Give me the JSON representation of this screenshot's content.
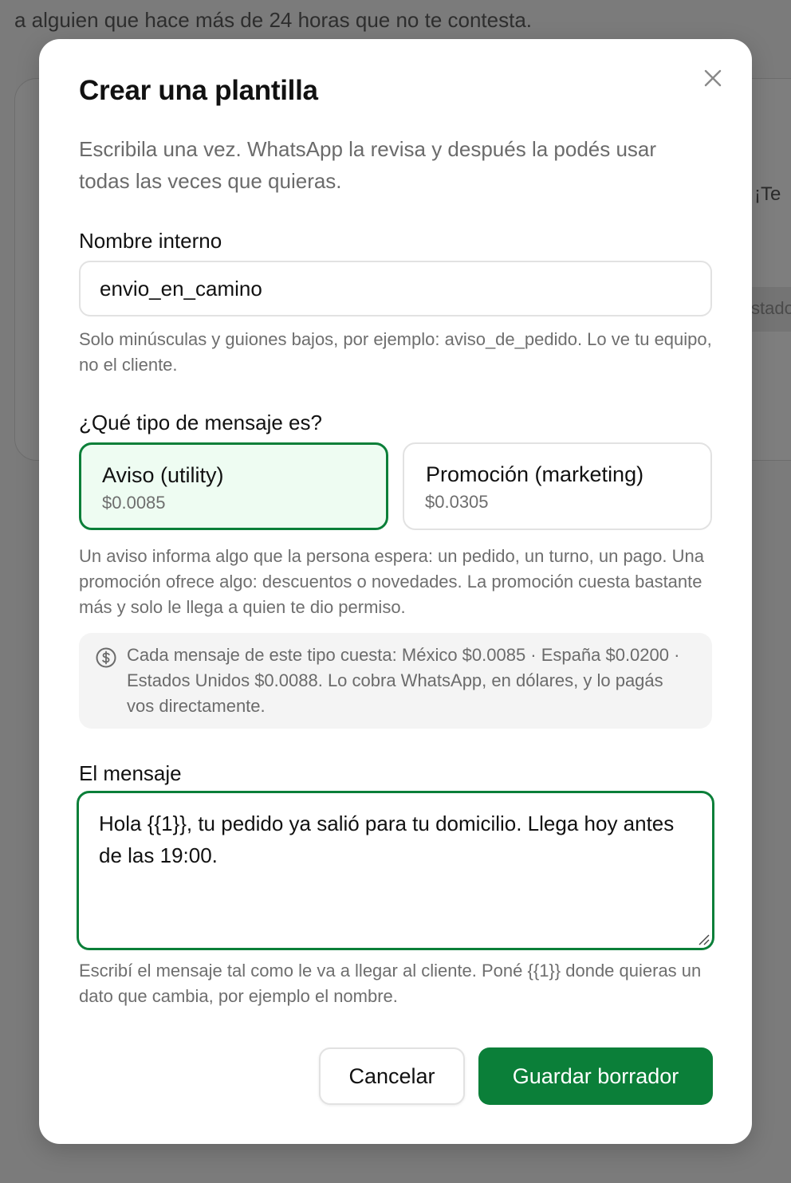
{
  "background": {
    "top_text": "a alguien que hace más de 24 horas que no te contesta.",
    "snippet_1": "¡Te",
    "snippet_2": "stado"
  },
  "modal": {
    "title": "Crear una plantilla",
    "subtitle": "Escribila una vez. WhatsApp la revisa y después la podés usar todas las veces que quieras.",
    "close_icon": "close-icon",
    "name_field": {
      "label": "Nombre interno",
      "value": "envio_en_camino",
      "hint": "Solo minúsculas y guiones bajos, por ejemplo: aviso_de_pedido. Lo ve tu equipo, no el cliente."
    },
    "type_field": {
      "label": "¿Qué tipo de mensaje es?",
      "options": [
        {
          "name": "Aviso (utility)",
          "price": "$0.0085",
          "selected": true
        },
        {
          "name": "Promoción (marketing)",
          "price": "$0.0305",
          "selected": false
        }
      ],
      "hint": "Un aviso informa algo que la persona espera: un pedido, un turno, un pago. Una promoción ofrece algo: descuentos o novedades. La promoción cuesta bastante más y solo le llega a quien te dio permiso.",
      "info_icon": "dollar-circle-icon",
      "info_text": "Cada mensaje de este tipo cuesta: México $0.0085 · España $0.0200 · Estados Unidos $0.0088. Lo cobra WhatsApp, en dólares, y lo pagás vos directamente."
    },
    "message_field": {
      "label": "El mensaje",
      "value": "Hola {{1}}, tu pedido ya salió para tu domicilio. Llega hoy antes de las 19:00.",
      "hint": "Escribí el mensaje tal como le va a llegar al cliente. Poné {{1}} donde quieras un dato que cambia, por ejemplo el nombre."
    },
    "actions": {
      "cancel_label": "Cancelar",
      "save_label": "Guardar borrador"
    },
    "colors": {
      "accent": "#0b7f39",
      "selected_bg": "#eefcf2"
    }
  }
}
